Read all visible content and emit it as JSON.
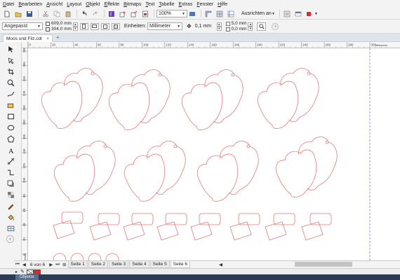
{
  "menu": [
    "Datei",
    "Bearbeiten",
    "Ansicht",
    "Layout",
    "Objekt",
    "Effekte",
    "Bitmaps",
    "Text",
    "Tabelle",
    "Extras",
    "Fenster",
    "Hilfe"
  ],
  "toolbar": {
    "zoom_value": "100%",
    "snap_label": "Ausrichten an"
  },
  "propbar": {
    "page_size": "Angepasst",
    "width": "609,0 mm",
    "height": "304,0 mm",
    "units_label": "Einheiten:",
    "units_value": "Millimeter",
    "nudge": "0,1 mm",
    "dup_x": "5,0 mm",
    "dup_y": "0,0 mm"
  },
  "document": {
    "tab_title": "Moos und Filz.cdr",
    "close_glyph": "×",
    "add_glyph": "+"
  },
  "ruler": {
    "top_ticks": [
      "0",
      "20",
      "40",
      "60",
      "80",
      "100",
      "120",
      "140",
      "160",
      "180",
      "200",
      "220",
      "240",
      "260",
      "280",
      "300"
    ],
    "top_unit": "Millimeter",
    "left_ticks": [
      "280",
      "260",
      "240",
      "220",
      "200",
      "180",
      "160",
      "140",
      "120",
      "100",
      "80",
      "60",
      "40",
      "20",
      "0"
    ],
    "left_unit": "Millimeter"
  },
  "pagebar": {
    "page_counter": "6 von 6",
    "pages": [
      "Seite 1",
      "Seite 2",
      "Seite 3",
      "Seite 4",
      "Seite 5",
      "Seite 6"
    ],
    "active_page": "Seite 6"
  },
  "dock": {
    "label": "Objekte"
  },
  "colors": {
    "cut_line": "#e07a7a",
    "guide": "#6f7fd1",
    "dock": "#2b3a55",
    "fill_swatch": "#d62b2b"
  },
  "icons": [
    "new-icon",
    "open-icon",
    "save-icon",
    "cut-icon",
    "copy-icon",
    "paste-icon",
    "undo-icon",
    "redo-icon",
    "search-icon",
    "import-icon",
    "export-icon",
    "publish-icon",
    "pick-tool-icon",
    "shape-tool-icon",
    "crop-tool-icon",
    "zoom-tool-icon",
    "freehand-tool-icon",
    "rectangle-tool-icon",
    "ellipse-tool-icon",
    "polygon-tool-icon",
    "text-tool-icon",
    "pen-tool-icon",
    "fill-tool-icon",
    "eyedropper-icon"
  ]
}
